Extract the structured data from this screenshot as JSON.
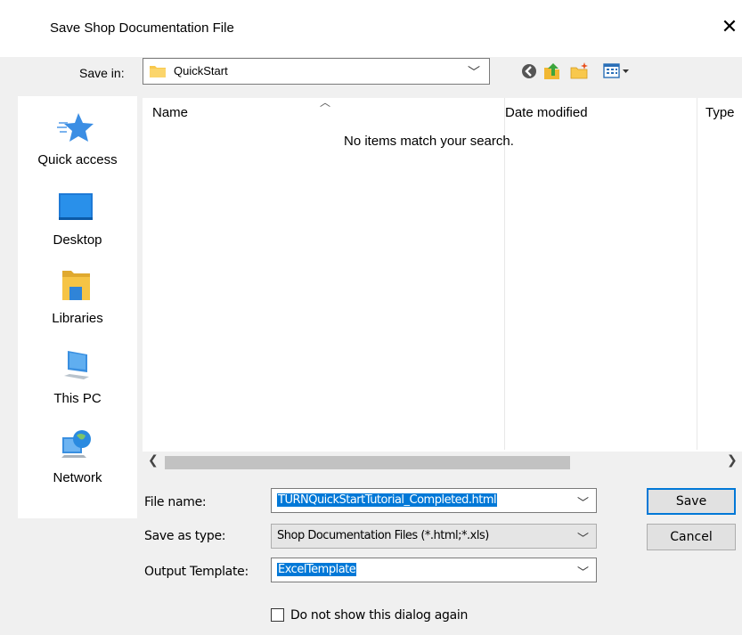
{
  "dialog": {
    "title": "Save Shop Documentation File",
    "close_label": "✕"
  },
  "save_in": {
    "label": "Save in:",
    "value": "QuickStart",
    "toolbar_icons": [
      "back-icon",
      "up-folder-icon",
      "new-folder-icon",
      "view-menu-icon"
    ]
  },
  "places": [
    {
      "label": "Quick access",
      "icon": "quick-access-star-icon"
    },
    {
      "label": "Desktop",
      "icon": "desktop-icon"
    },
    {
      "label": "Libraries",
      "icon": "libraries-icon"
    },
    {
      "label": "This PC",
      "icon": "this-pc-icon"
    },
    {
      "label": "Network",
      "icon": "network-icon"
    }
  ],
  "list": {
    "columns": [
      "Name",
      "Date modified",
      "Type"
    ],
    "empty_message": "No items match your search."
  },
  "form": {
    "file_name_label": "File name:",
    "file_name_value": "TURNQuickStartTutorial_Completed.html",
    "save_type_label": "Save as type:",
    "save_type_value": "Shop Documentation Files (*.html;*.xls)",
    "template_label": "Output Template:",
    "template_value": "ExcelTemplate",
    "checkbox_label": "Do not show this dialog again"
  },
  "buttons": {
    "save": "Save",
    "cancel": "Cancel"
  },
  "colors": {
    "accent": "#0078d7",
    "folder": "#f8c84c"
  }
}
